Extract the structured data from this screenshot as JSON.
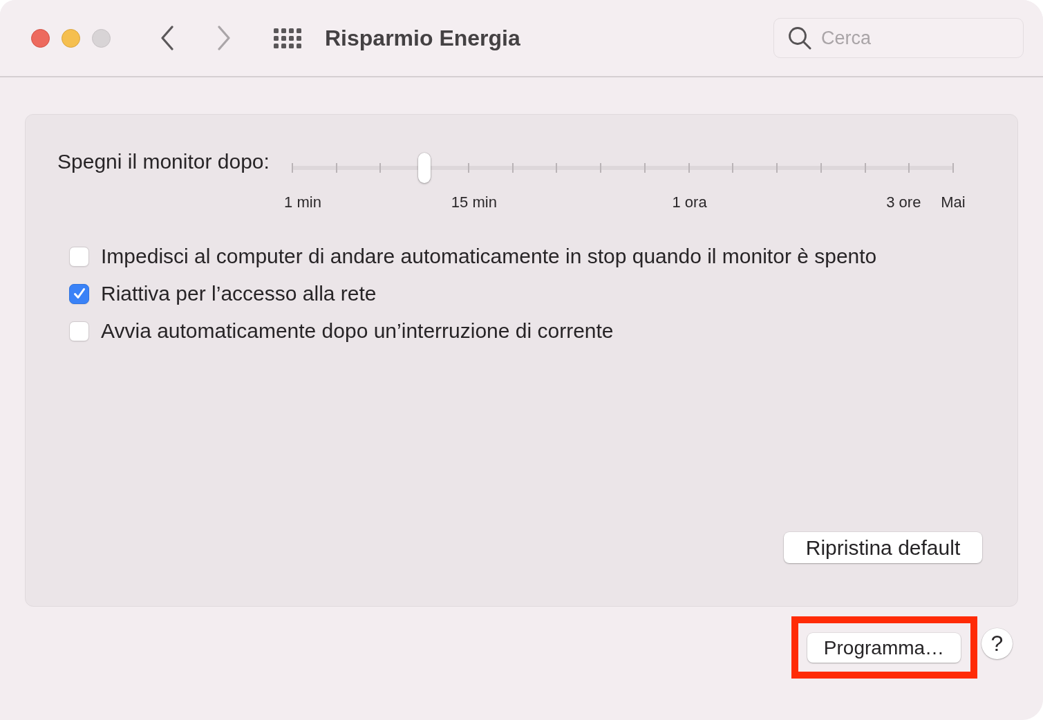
{
  "window": {
    "title": "Risparmio Energia",
    "buttons": [
      {
        "kind": "close",
        "disabled": false
      },
      {
        "kind": "minimize",
        "disabled": false
      },
      {
        "kind": "zoom",
        "disabled": true
      }
    ]
  },
  "navigation": [
    {
      "kind": "back",
      "disabled": false
    },
    {
      "kind": "forward",
      "disabled": true
    }
  ],
  "search": {
    "placeholder": "Cerca"
  },
  "panel": {
    "slider": {
      "label": "Spegni il monitor dopo:",
      "level": 0.2,
      "tick_labels": [
        "1 min",
        "15 min",
        "1 ora",
        "3 ore",
        "Mai"
      ]
    },
    "options": [
      {
        "label": "Impedisci al computer di andare automaticamente in stop quando il monitor è spento",
        "checked": false
      },
      {
        "label": "Riattiva per l’accesso alla rete",
        "checked": true
      },
      {
        "label": "Avvia automaticamente dopo un’interruzione di corrente",
        "checked": false
      }
    ],
    "buttons": [
      {
        "label": "Ripristina default"
      }
    ]
  },
  "footer": {
    "buttons": [
      {
        "label": "Programma…",
        "highlighted": true
      }
    ],
    "help": {
      "label": "?"
    }
  }
}
